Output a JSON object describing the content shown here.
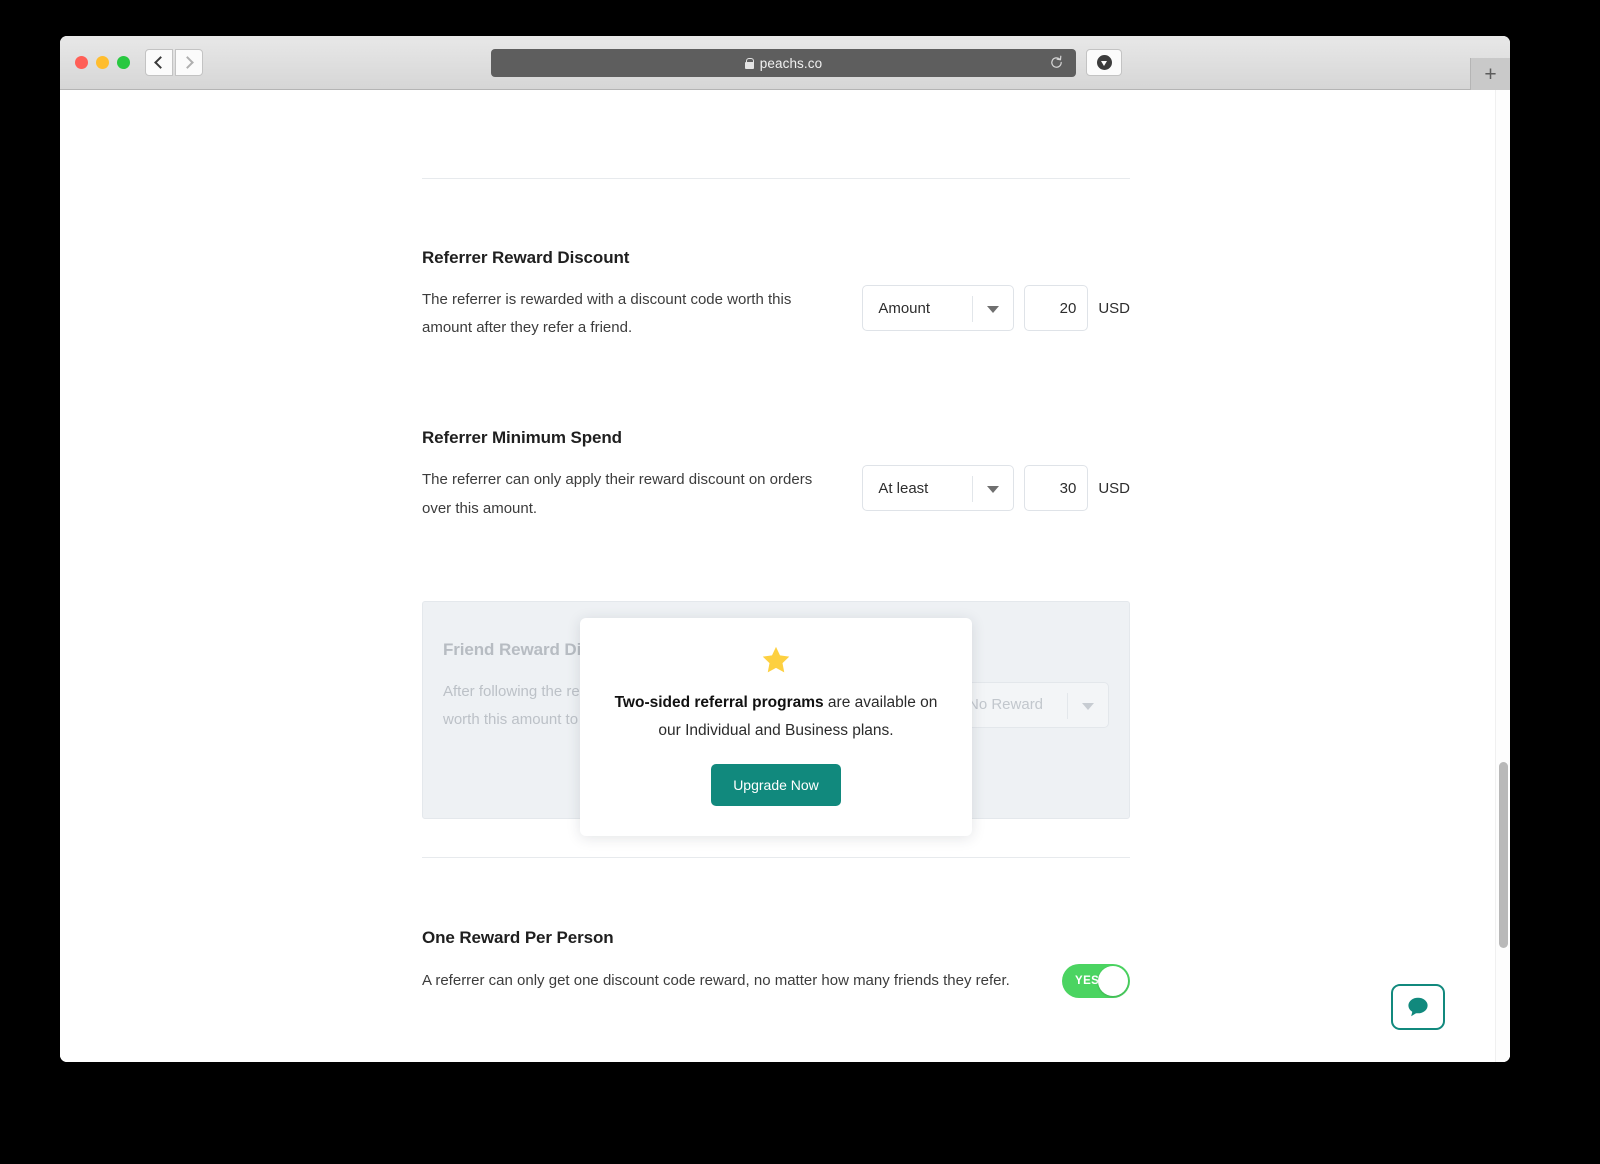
{
  "browser": {
    "url": "peachs.co",
    "lock_icon": "lock-icon",
    "reload_icon": "reload-icon",
    "download_icon": "download-icon",
    "back_icon": "chevron-left-icon",
    "forward_icon": "chevron-right-icon",
    "newtab_label": "+"
  },
  "settings": [
    {
      "title": "Referrer Reward Discount",
      "description": "The referrer is rewarded with a discount code worth this amount after they refer a friend.",
      "select_value": "Amount",
      "amount": "20",
      "currency": "USD"
    },
    {
      "title": "Referrer Minimum Spend",
      "description": "The referrer can only apply their reward discount on orders over this amount.",
      "select_value": "At least",
      "amount": "30",
      "currency": "USD"
    }
  ],
  "locked_section": {
    "title": "Friend Reward Discount",
    "description": "After following the referral link, the friend gets a discount code worth this amount to use on their first order.",
    "select_value": "No Reward"
  },
  "upsell": {
    "icon": "star-icon",
    "text_bold": "Two-sided referral programs",
    "text_rest": " are available on our Individual and Business plans.",
    "button_label": "Upgrade Now",
    "button_color": "#11897d",
    "star_color": "#fdd040"
  },
  "one_reward": {
    "title": "One Reward Per Person",
    "description": "A referrer can only get one discount code reward, no matter how many friends they refer.",
    "toggle_label": "YES",
    "toggle_color": "#4bd461"
  },
  "chat": {
    "icon": "chat-bubble-icon",
    "accent_color": "#11897d"
  }
}
